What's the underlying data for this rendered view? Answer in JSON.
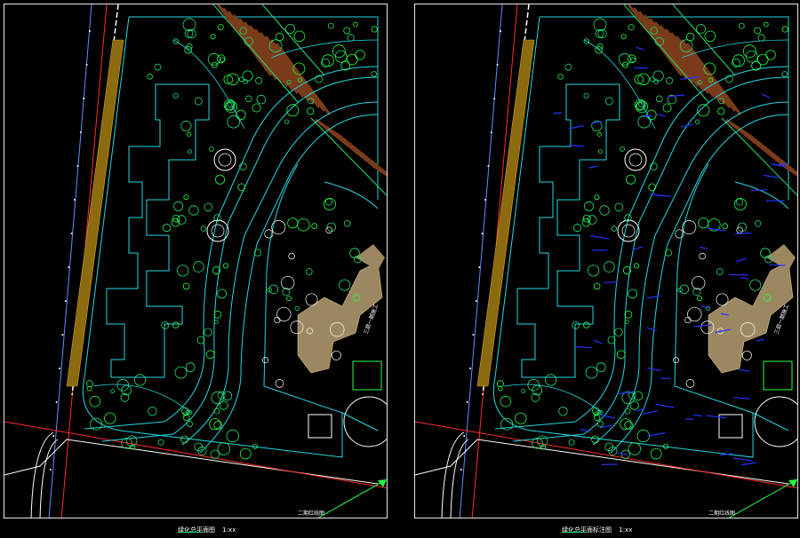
{
  "colors": {
    "background": "#000000",
    "frame": "#e8e8e8",
    "boundary_cyan": "#22d8e0",
    "plant_green": "#22e070",
    "bright_green": "#22ff44",
    "road_red": "#ff2a2a",
    "brown_strip": "#8b6a10",
    "building_tan": "#9c8860",
    "blue_annotation": "#2433ff",
    "white": "#ffffff",
    "pergola_brown": "#7a3b1a"
  },
  "panels": [
    {
      "id": "left",
      "caption": "绿化总平面图",
      "scale": "1:xx",
      "road_label": "二期红线图",
      "building_label": "三层一期施工",
      "annotations": false
    },
    {
      "id": "right",
      "caption": "绿化总平面标注图",
      "scale": "1:xx",
      "road_label": "二期红线图",
      "building_label": "三层一期施工",
      "annotations": true
    }
  ]
}
